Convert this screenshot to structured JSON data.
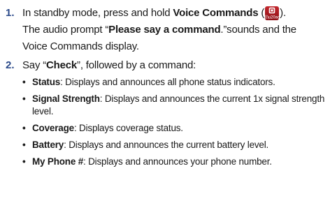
{
  "steps": [
    {
      "number": "1.",
      "line1_before_bold": "In standby mode, press and hold ",
      "line1_bold": "Voice Commands",
      "line1_paren_open": " (",
      "line1_paren_close": ").",
      "icon": "voice-commands-icon",
      "line2_before_quote": "The audio prompt “",
      "line2_bold": "Please say a command",
      "line2_after": ".”sounds and the",
      "line3": "Voice Commands display."
    },
    {
      "number": "2.",
      "text_before": "Say “",
      "text_bold": "Check",
      "text_after": "”, followed by a command:"
    }
  ],
  "commands": [
    {
      "name": "Status",
      "desc": ": Displays and announces all phone status indicators."
    },
    {
      "name": "Signal Strength",
      "desc": ": Displays and announces the current 1x signal strength level."
    },
    {
      "name": "Coverage",
      "desc": ": Displays coverage status."
    },
    {
      "name": "Battery",
      "desc": ": Displays and announces the current battery level."
    },
    {
      "name": "My Phone #",
      "desc": ": Displays and announces your phone number."
    }
  ],
  "colors": {
    "step_number": "#2b4a8a",
    "icon_background": "#b01e24"
  }
}
